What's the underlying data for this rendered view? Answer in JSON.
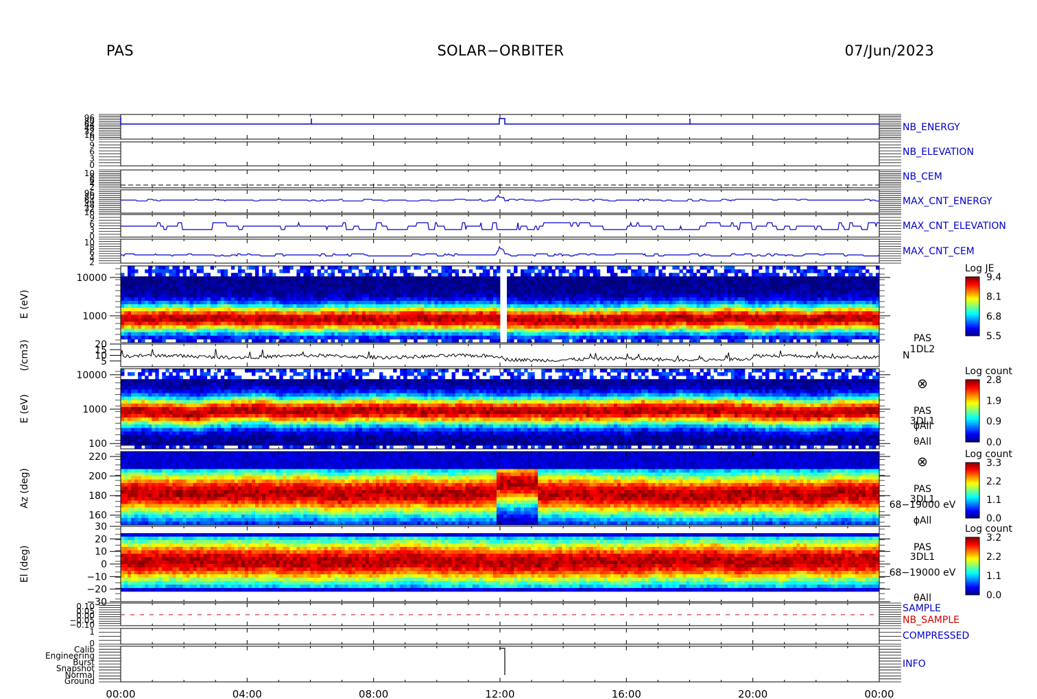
{
  "header": {
    "instrument": "PAS",
    "mission": "SOLAR−ORBITER",
    "date": "07/Jun/2023"
  },
  "chart_data": {
    "type": "heatmap",
    "time_axis": {
      "ticks": [
        "00:00",
        "04:00",
        "08:00",
        "12:00",
        "16:00",
        "20:00",
        "00:00"
      ],
      "range_hours": [
        0,
        24
      ]
    },
    "colors": {
      "trace": "#0000c8",
      "trace_black": "#000000",
      "label_blue": "#0000c8",
      "label_red": "#d00000"
    },
    "panels": [
      {
        "id": "nb_energy",
        "label": "NB_ENERGY",
        "label_color": "blue",
        "ytick_labels": [
          "96",
          "80",
          "64",
          "48",
          "32",
          "16",
          "0"
        ],
        "kind": "step"
      },
      {
        "id": "nb_elevation",
        "label": "NB_ELEVATION",
        "label_color": "blue",
        "ytick_labels": [
          "9",
          "6",
          "3",
          "0"
        ],
        "kind": "flat"
      },
      {
        "id": "nb_cem",
        "label": "NB_CEM",
        "label_color": "blue",
        "ytick_labels": [
          "10",
          "8",
          "6",
          "4",
          "2"
        ],
        "kind": "dashed"
      },
      {
        "id": "max_cnt_energy",
        "label": "MAX_CNT_ENERGY",
        "label_color": "blue",
        "ytick_labels": [
          "96",
          "80",
          "64",
          "48",
          "32",
          "16"
        ],
        "kind": "trace"
      },
      {
        "id": "max_cnt_elevation",
        "label": "MAX_CNT_ELEVATION",
        "label_color": "blue",
        "ytick_labels": [
          "9",
          "6",
          "3",
          "0"
        ],
        "kind": "trace"
      },
      {
        "id": "max_cnt_cem",
        "label": "MAX_CNT_CEM",
        "label_color": "blue",
        "ytick_labels": [
          "10",
          "8",
          "6",
          "4",
          "2"
        ],
        "kind": "trace"
      },
      {
        "id": "energy_1dl2",
        "kind": "spectrogram",
        "ylabel": "E (eV)",
        "yticks": [
          {
            "value": 10000,
            "label": "10000"
          },
          {
            "value": 1000,
            "label": "1000"
          }
        ],
        "ylim": [
          200,
          20000
        ],
        "yscale": "log",
        "colorbar": {
          "title": "Log JE",
          "ticks": [
            "9.4",
            "8.1",
            "6.8",
            "5.5"
          ],
          "range": [
            5.5,
            9.4
          ]
        },
        "peak_energy_ev": 800,
        "side_labels": [
          "PAS",
          "1DL2"
        ]
      },
      {
        "id": "density",
        "kind": "line",
        "ylabel": "(/cm3)",
        "yticks": [
          {
            "value": 20,
            "label": "20"
          },
          {
            "value": 15,
            "label": "15"
          },
          {
            "value": 10,
            "label": "10"
          },
          {
            "value": 5,
            "label": "5"
          }
        ],
        "ylim": [
          0,
          20
        ],
        "typical_value": 9,
        "side_labels": [
          "N"
        ]
      },
      {
        "id": "energy_3dl1",
        "kind": "spectrogram",
        "ylabel": "E (eV)",
        "yticks": [
          {
            "value": 10000,
            "label": "10000"
          },
          {
            "value": 1000,
            "label": "1000"
          },
          {
            "value": 100,
            "label": "100"
          }
        ],
        "ylim": [
          70,
          15000
        ],
        "yscale": "log",
        "colorbar": {
          "title": "Log count",
          "ticks": [
            "2.8",
            "1.9",
            "0.9",
            "0.0"
          ],
          "range": [
            0.0,
            2.8
          ]
        },
        "peak_energy_ev": 850,
        "side_labels": [
          "⊗",
          "PAS",
          "3DL1",
          "ϕAll",
          "θAll"
        ]
      },
      {
        "id": "azimuth",
        "kind": "spectrogram",
        "ylabel": "Az (deg)",
        "yticks": [
          {
            "value": 220,
            "label": "220"
          },
          {
            "value": 200,
            "label": "200"
          },
          {
            "value": 180,
            "label": "180"
          },
          {
            "value": 160,
            "label": "160"
          }
        ],
        "ylim": [
          150,
          225
        ],
        "colorbar": {
          "title": "Log count",
          "ticks": [
            "3.3",
            "2.2",
            "1.1",
            "0.0"
          ],
          "range": [
            0.0,
            3.3
          ]
        },
        "peak_value_deg": 182,
        "side_labels": [
          "⊗",
          "PAS",
          "3DL1",
          "68−19000 eV",
          "ϕAll"
        ]
      },
      {
        "id": "elevation",
        "kind": "spectrogram",
        "ylabel": "El (deg)",
        "yticks": [
          {
            "value": 30,
            "label": "30"
          },
          {
            "value": 20,
            "label": "20"
          },
          {
            "value": 10,
            "label": "10"
          },
          {
            "value": 0,
            "label": "0"
          },
          {
            "value": -10,
            "label": "−10"
          },
          {
            "value": -20,
            "label": "−20"
          },
          {
            "value": -30,
            "label": "−30"
          }
        ],
        "ylim": [
          -30,
          30
        ],
        "colorbar": {
          "title": "Log count",
          "ticks": [
            "3.2",
            "2.2",
            "1.1",
            "0.0"
          ],
          "range": [
            0.0,
            3.2
          ]
        },
        "peak_value_deg": 2,
        "side_labels": [
          "PAS",
          "3DL1",
          "68−19000 eV",
          "θAll"
        ]
      },
      {
        "id": "sample",
        "kind": "dashed_red",
        "ytick_labels": [
          "0.10",
          "0.05",
          "0.00",
          "−0.05",
          "−0.10"
        ],
        "labels": [
          {
            "text": "SAMPLE",
            "color": "blue"
          },
          {
            "text": "NB_SAMPLE",
            "color": "red"
          }
        ]
      },
      {
        "id": "compressed",
        "label": "COMPRESSED",
        "label_color": "blue",
        "ytick_labels": [
          "1",
          "0"
        ],
        "kind": "flat"
      },
      {
        "id": "info",
        "label": "INFO",
        "label_color": "blue",
        "ytick_labels": [
          "Calib",
          "Engineering",
          "Burst",
          "Snapshot",
          "Normal",
          "Ground"
        ],
        "kind": "info"
      }
    ]
  }
}
